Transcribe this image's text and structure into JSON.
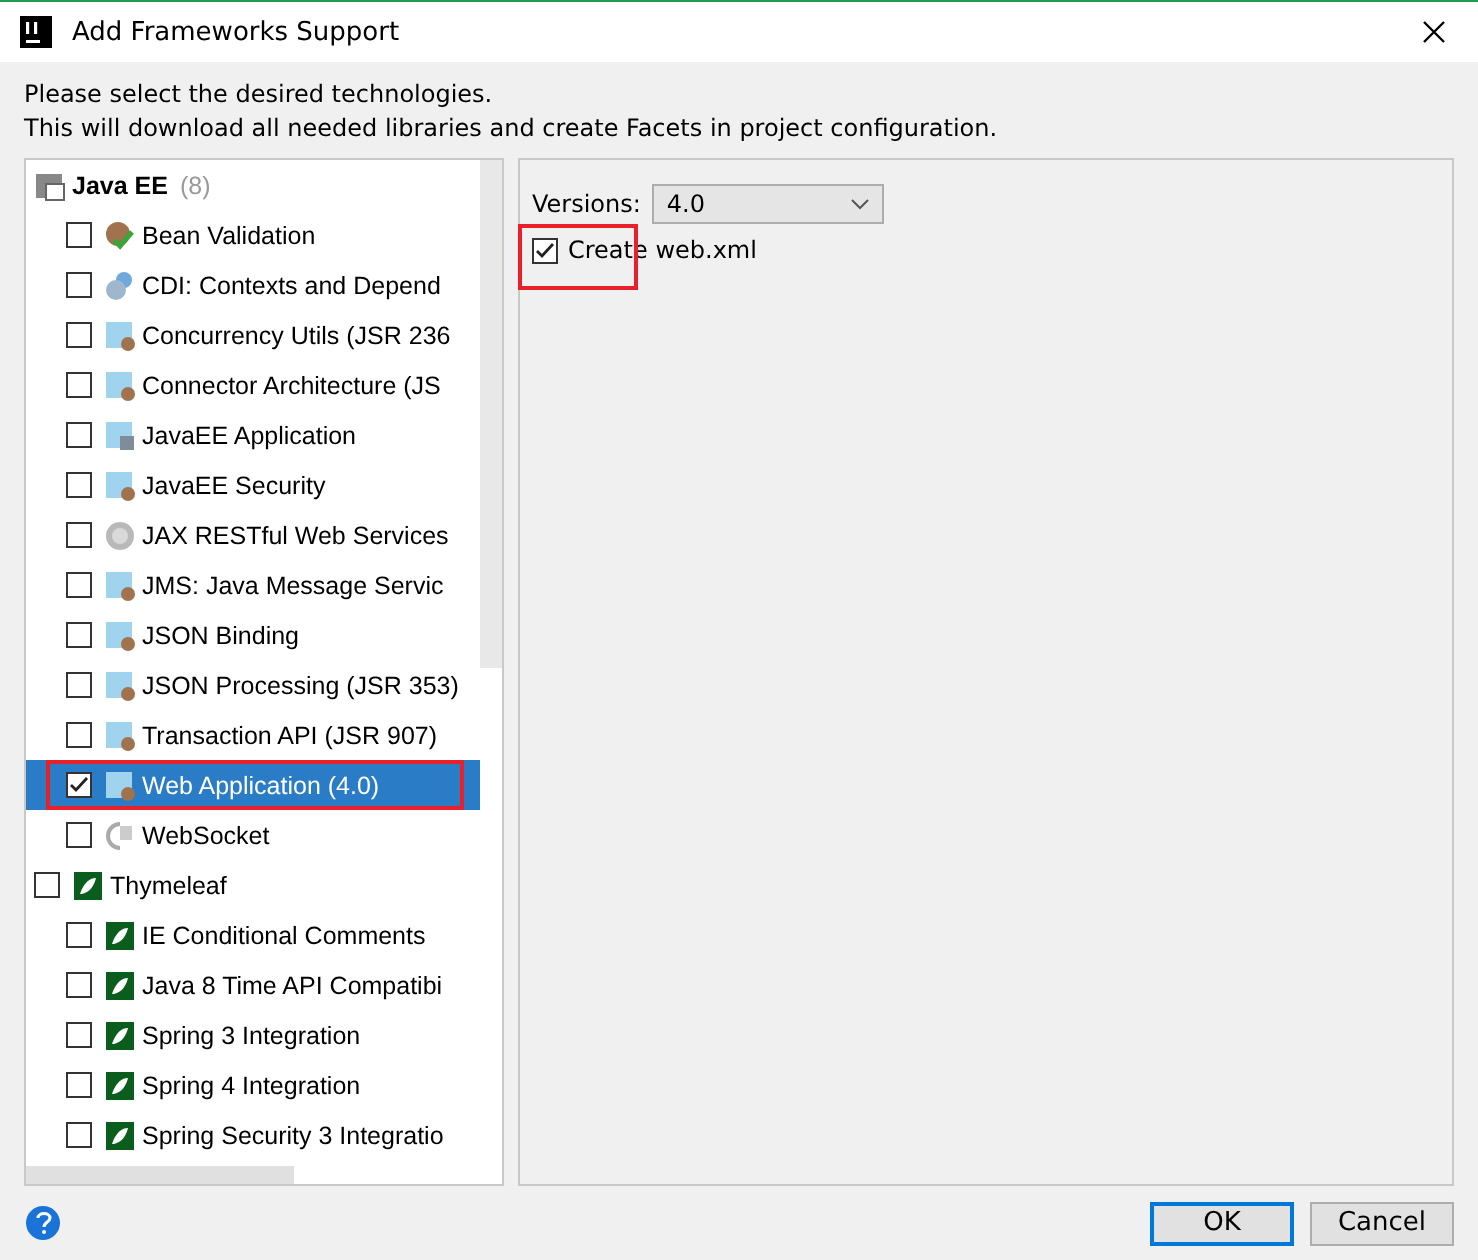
{
  "window": {
    "title": "Add Frameworks Support"
  },
  "description": [
    "Please select the desired technologies.",
    "This will download all needed libraries and create Facets in project configuration."
  ],
  "tree": [
    {
      "label": "Java EE",
      "count": "(8)",
      "kind": "javaee",
      "children": [
        {
          "label": "Bean Validation",
          "checked": false,
          "selected": false,
          "highlighted": false
        },
        {
          "label": "CDI: Contexts and Depend",
          "checked": false,
          "selected": false,
          "highlighted": false
        },
        {
          "label": "Concurrency Utils (JSR 236",
          "checked": false,
          "selected": false,
          "highlighted": false
        },
        {
          "label": "Connector Architecture (JS",
          "checked": false,
          "selected": false,
          "highlighted": false
        },
        {
          "label": "JavaEE Application",
          "checked": false,
          "selected": false,
          "highlighted": false
        },
        {
          "label": "JavaEE Security",
          "checked": false,
          "selected": false,
          "highlighted": false
        },
        {
          "label": "JAX RESTful Web Services",
          "checked": false,
          "selected": false,
          "highlighted": false
        },
        {
          "label": "JMS: Java Message Servic",
          "checked": false,
          "selected": false,
          "highlighted": false
        },
        {
          "label": "JSON Binding",
          "checked": false,
          "selected": false,
          "highlighted": false
        },
        {
          "label": "JSON Processing (JSR 353)",
          "checked": false,
          "selected": false,
          "highlighted": false
        },
        {
          "label": "Transaction API (JSR 907)",
          "checked": false,
          "selected": false,
          "highlighted": false
        },
        {
          "label": "Web Application (4.0)",
          "checked": true,
          "selected": true,
          "highlighted": true
        },
        {
          "label": "WebSocket",
          "checked": false,
          "selected": false,
          "highlighted": false
        }
      ]
    },
    {
      "label": "Thymeleaf",
      "kind": "thymeleaf",
      "checked": false,
      "children": [
        {
          "label": "IE Conditional Comments",
          "checked": false,
          "selected": false,
          "highlighted": false
        },
        {
          "label": "Java 8 Time API Compatibi",
          "checked": false,
          "selected": false,
          "highlighted": false
        },
        {
          "label": "Spring 3 Integration",
          "checked": false,
          "selected": false,
          "highlighted": false
        },
        {
          "label": "Spring 4 Integration",
          "checked": false,
          "selected": false,
          "highlighted": false
        },
        {
          "label": "Spring Security 3 Integratio",
          "checked": false,
          "selected": false,
          "highlighted": false
        }
      ]
    }
  ],
  "settings": {
    "versions_label": "Versions:",
    "version": "4.0",
    "create_option": {
      "label": "Create web.xml",
      "checked": true,
      "highlighted": true
    }
  },
  "buttons": [
    {
      "label": "OK",
      "default": true
    },
    {
      "label": "Cancel",
      "default": false
    }
  ]
}
